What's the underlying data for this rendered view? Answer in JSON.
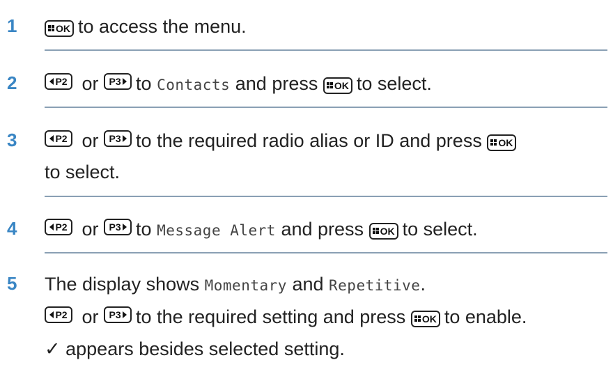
{
  "colors": {
    "step_number": "#3a86c4",
    "divider": "#8aa0b4",
    "text": "#222222"
  },
  "keys": {
    "ok": "OK",
    "p2": "P2",
    "p3": "P3"
  },
  "steps": [
    {
      "number": "1",
      "text_a": "to access the menu."
    },
    {
      "number": "2",
      "or": "or",
      "text_a": "to",
      "menu_item": "Contacts",
      "text_b": "and press",
      "text_c": "to select."
    },
    {
      "number": "3",
      "or": "or",
      "text_a": "to the required radio alias or ID and press",
      "text_c": "to select."
    },
    {
      "number": "4",
      "or": "or",
      "text_a": "to",
      "menu_item": "Message Alert",
      "text_b": "and press",
      "text_c": "to select."
    },
    {
      "number": "5",
      "line1_a": "The display shows",
      "option_1": "Momentary",
      "line1_b": "and",
      "option_2": "Repetitive",
      "line1_c": ".",
      "or": "or",
      "line2_a": "to the required setting and press",
      "line2_b": "to enable.",
      "line3": "✓ appears besides selected setting."
    }
  ]
}
